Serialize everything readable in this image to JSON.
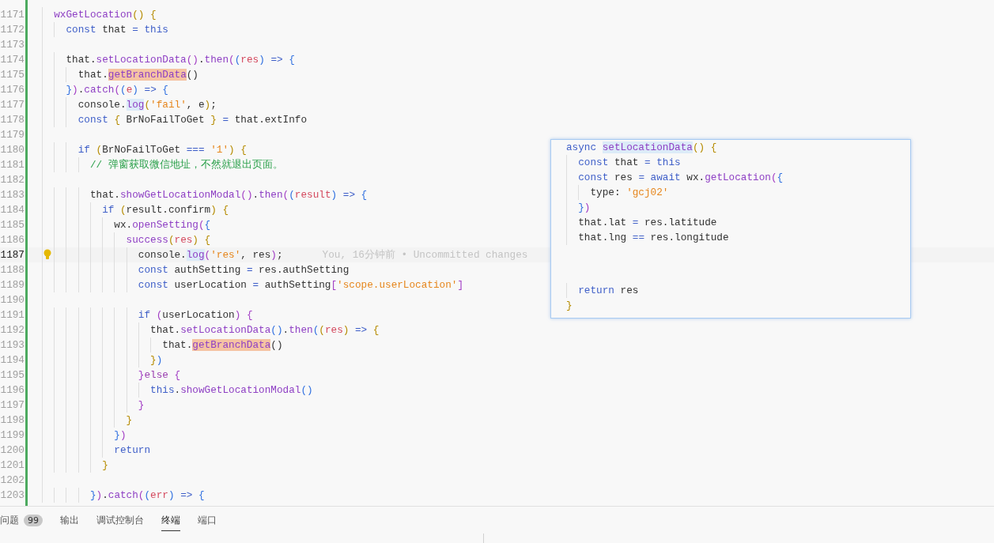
{
  "editor": {
    "lines": [
      {
        "number": "1171",
        "current": false,
        "tokens": [
          {
            "text": "  wxGetLocation",
            "kind": "fn"
          },
          {
            "text": "() {",
            "kind": "b1"
          }
        ]
      },
      {
        "number": "1172",
        "current": false,
        "tokens": [
          {
            "text": "    const",
            "kind": "kw"
          },
          {
            "text": " that ",
            "kind": "p"
          },
          {
            "text": "= ",
            "kind": "op"
          },
          {
            "text": "this",
            "kind": "kw"
          }
        ]
      },
      {
        "number": "1173",
        "current": false
      },
      {
        "number": "1174",
        "current": false,
        "tokens": [
          {
            "text": "    that.",
            "kind": "p"
          },
          {
            "text": "setLocationData",
            "kind": "fn"
          },
          {
            "text": "()",
            "kind": "b2"
          },
          {
            "text": ".",
            "kind": "p"
          },
          {
            "text": "then",
            "kind": "fn"
          },
          {
            "text": "(",
            "kind": "b2"
          },
          {
            "text": "(",
            "kind": "b3"
          },
          {
            "text": "res",
            "kind": "pr"
          },
          {
            "text": ") ",
            "kind": "b3"
          },
          {
            "text": "=> ",
            "kind": "op"
          },
          {
            "text": "{",
            "kind": "b3"
          }
        ]
      },
      {
        "number": "1175",
        "current": false,
        "tokens": [
          {
            "text": "      that.",
            "kind": "p"
          },
          {
            "text": "getBranchData",
            "kind": "fn_match"
          },
          {
            "text": "()",
            "kind": "p"
          }
        ]
      },
      {
        "number": "1176",
        "current": false,
        "tokens": [
          {
            "text": "    }",
            "kind": "b3"
          },
          {
            "text": ")",
            "kind": "b2"
          },
          {
            "text": ".",
            "kind": "p"
          },
          {
            "text": "catch",
            "kind": "fn"
          },
          {
            "text": "(",
            "kind": "b2"
          },
          {
            "text": "(",
            "kind": "b3"
          },
          {
            "text": "e",
            "kind": "pr"
          },
          {
            "text": ") ",
            "kind": "b3"
          },
          {
            "text": "=> ",
            "kind": "op"
          },
          {
            "text": "{",
            "kind": "b3"
          }
        ]
      },
      {
        "number": "1177",
        "current": false,
        "tokens": [
          {
            "text": "      console.",
            "kind": "p"
          },
          {
            "text": "log",
            "kind": "fn_ref"
          },
          {
            "text": "(",
            "kind": "b1"
          },
          {
            "text": "'fail'",
            "kind": "st"
          },
          {
            "text": ", e",
            "kind": "p"
          },
          {
            "text": ")",
            "kind": "b1"
          },
          {
            "text": ";",
            "kind": "p"
          }
        ]
      },
      {
        "number": "1178",
        "current": false,
        "tokens": [
          {
            "text": "      const ",
            "kind": "kw"
          },
          {
            "text": "{",
            "kind": "b1"
          },
          {
            "text": " BrNoFailToGet ",
            "kind": "p"
          },
          {
            "text": "} ",
            "kind": "b1"
          },
          {
            "text": "=",
            "kind": "op"
          },
          {
            "text": " that.extInfo",
            "kind": "p"
          }
        ]
      },
      {
        "number": "1179",
        "current": false
      },
      {
        "number": "1180",
        "current": false,
        "tokens": [
          {
            "text": "      if ",
            "kind": "kw"
          },
          {
            "text": "(",
            "kind": "b1"
          },
          {
            "text": "BrNoFailToGet ",
            "kind": "p"
          },
          {
            "text": "=== ",
            "kind": "op"
          },
          {
            "text": "'1'",
            "kind": "st"
          },
          {
            "text": ") {",
            "kind": "b1"
          }
        ]
      },
      {
        "number": "1181",
        "current": false,
        "tokens": [
          {
            "text": "        // 弹窗获取微信地址，不然就退出页面。",
            "kind": "cm"
          }
        ]
      },
      {
        "number": "1182",
        "current": false
      },
      {
        "number": "1183",
        "current": false,
        "tokens": [
          {
            "text": "        that.",
            "kind": "p"
          },
          {
            "text": "showGetLocationModal",
            "kind": "fn"
          },
          {
            "text": "()",
            "kind": "b2"
          },
          {
            "text": ".",
            "kind": "p"
          },
          {
            "text": "then",
            "kind": "fn"
          },
          {
            "text": "(",
            "kind": "b2"
          },
          {
            "text": "(",
            "kind": "b3"
          },
          {
            "text": "result",
            "kind": "pr"
          },
          {
            "text": ") ",
            "kind": "b3"
          },
          {
            "text": "=> ",
            "kind": "op"
          },
          {
            "text": "{",
            "kind": "b3"
          }
        ]
      },
      {
        "number": "1184",
        "current": false,
        "tokens": [
          {
            "text": "          if ",
            "kind": "kw"
          },
          {
            "text": "(",
            "kind": "b1"
          },
          {
            "text": "result.confirm",
            "kind": "p"
          },
          {
            "text": ") {",
            "kind": "b1"
          }
        ]
      },
      {
        "number": "1185",
        "current": false,
        "tokens": [
          {
            "text": "            wx.",
            "kind": "p"
          },
          {
            "text": "openSetting",
            "kind": "fn"
          },
          {
            "text": "(",
            "kind": "b2"
          },
          {
            "text": "{",
            "kind": "b3"
          }
        ]
      },
      {
        "number": "1186",
        "current": false,
        "tokens": [
          {
            "text": "              success",
            "kind": "fn"
          },
          {
            "text": "(",
            "kind": "b1"
          },
          {
            "text": "res",
            "kind": "pr"
          },
          {
            "text": ") {",
            "kind": "b1"
          }
        ]
      },
      {
        "number": "1187",
        "current": true,
        "annotation": "You, 16分钟前 • Uncommitted changes",
        "tokens": [
          {
            "text": "                console.",
            "kind": "p"
          },
          {
            "text": "log",
            "kind": "fn_ref"
          },
          {
            "text": "(",
            "kind": "b2"
          },
          {
            "text": "'res'",
            "kind": "st"
          },
          {
            "text": ", res",
            "kind": "p"
          },
          {
            "text": ")",
            "kind": "b2"
          },
          {
            "text": ";",
            "kind": "p"
          }
        ]
      },
      {
        "number": "1188",
        "current": false,
        "tokens": [
          {
            "text": "                const",
            "kind": "kw"
          },
          {
            "text": " authSetting ",
            "kind": "p"
          },
          {
            "text": "=",
            "kind": "op"
          },
          {
            "text": " res.authSetting",
            "kind": "p"
          }
        ]
      },
      {
        "number": "1189",
        "current": false,
        "tokens": [
          {
            "text": "                const",
            "kind": "kw"
          },
          {
            "text": " userLocation ",
            "kind": "p"
          },
          {
            "text": "=",
            "kind": "op"
          },
          {
            "text": " authSetting",
            "kind": "p"
          },
          {
            "text": "[",
            "kind": "b2"
          },
          {
            "text": "'scope.userLocation'",
            "kind": "st"
          },
          {
            "text": "]",
            "kind": "b2"
          }
        ]
      },
      {
        "number": "1190",
        "current": false
      },
      {
        "number": "1191",
        "current": false,
        "tokens": [
          {
            "text": "                if ",
            "kind": "kw"
          },
          {
            "text": "(",
            "kind": "b2"
          },
          {
            "text": "userLocation",
            "kind": "p"
          },
          {
            "text": ") {",
            "kind": "b2"
          }
        ]
      },
      {
        "number": "1192",
        "current": false,
        "tokens": [
          {
            "text": "                  that.",
            "kind": "p"
          },
          {
            "text": "setLocationData",
            "kind": "fn"
          },
          {
            "text": "()",
            "kind": "b3"
          },
          {
            "text": ".",
            "kind": "p"
          },
          {
            "text": "then",
            "kind": "fn"
          },
          {
            "text": "(",
            "kind": "b3"
          },
          {
            "text": "(",
            "kind": "b1"
          },
          {
            "text": "res",
            "kind": "pr"
          },
          {
            "text": ") ",
            "kind": "b1"
          },
          {
            "text": "=> ",
            "kind": "op"
          },
          {
            "text": "{",
            "kind": "b1"
          }
        ]
      },
      {
        "number": "1193",
        "current": false,
        "tokens": [
          {
            "text": "                    that.",
            "kind": "p"
          },
          {
            "text": "getBranchData",
            "kind": "fn_match"
          },
          {
            "text": "()",
            "kind": "p"
          }
        ]
      },
      {
        "number": "1194",
        "current": false,
        "tokens": [
          {
            "text": "                  }",
            "kind": "b1"
          },
          {
            "text": ")",
            "kind": "b3"
          }
        ]
      },
      {
        "number": "1195",
        "current": false,
        "tokens": [
          {
            "text": "                }",
            "kind": "b2"
          },
          {
            "text": "else ",
            "kind": "kw2"
          },
          {
            "text": "{",
            "kind": "b2"
          }
        ]
      },
      {
        "number": "1196",
        "current": false,
        "tokens": [
          {
            "text": "                  this",
            "kind": "kw"
          },
          {
            "text": ".",
            "kind": "p"
          },
          {
            "text": "showGetLocationModal",
            "kind": "fn"
          },
          {
            "text": "()",
            "kind": "b3"
          }
        ]
      },
      {
        "number": "1197",
        "current": false,
        "tokens": [
          {
            "text": "                }",
            "kind": "b2"
          }
        ]
      },
      {
        "number": "1198",
        "current": false,
        "tokens": [
          {
            "text": "              }",
            "kind": "b1"
          }
        ]
      },
      {
        "number": "1199",
        "current": false,
        "tokens": [
          {
            "text": "            }",
            "kind": "b3"
          },
          {
            "text": ")",
            "kind": "b2"
          }
        ]
      },
      {
        "number": "1200",
        "current": false,
        "tokens": [
          {
            "text": "            return",
            "kind": "kw"
          }
        ]
      },
      {
        "number": "1201",
        "current": false,
        "tokens": [
          {
            "text": "          }",
            "kind": "b1"
          }
        ]
      },
      {
        "number": "1202",
        "current": false
      },
      {
        "number": "1203",
        "current": false,
        "tokens": [
          {
            "text": "        }",
            "kind": "b3"
          },
          {
            "text": ")",
            "kind": "b2"
          },
          {
            "text": ".",
            "kind": "p"
          },
          {
            "text": "catch",
            "kind": "fn"
          },
          {
            "text": "(",
            "kind": "b2"
          },
          {
            "text": "(",
            "kind": "b3"
          },
          {
            "text": "err",
            "kind": "pr"
          },
          {
            "text": ") ",
            "kind": "b3"
          },
          {
            "text": "=> ",
            "kind": "op"
          },
          {
            "text": "{",
            "kind": "b3"
          }
        ]
      }
    ]
  },
  "hover_preview": {
    "lines": [
      {
        "tokens": [
          {
            "text": "async ",
            "kind": "kw"
          },
          {
            "text": "setLocationData",
            "kind": "fn_ref"
          },
          {
            "text": "() {",
            "kind": "b1"
          }
        ]
      },
      {
        "tokens": [
          {
            "text": "  const",
            "kind": "kw"
          },
          {
            "text": " that ",
            "kind": "p"
          },
          {
            "text": "= ",
            "kind": "op"
          },
          {
            "text": "this",
            "kind": "kw"
          }
        ]
      },
      {
        "tokens": [
          {
            "text": "  const",
            "kind": "kw"
          },
          {
            "text": " res ",
            "kind": "p"
          },
          {
            "text": "= ",
            "kind": "op"
          },
          {
            "text": "await",
            "kind": "kw"
          },
          {
            "text": " wx.",
            "kind": "p"
          },
          {
            "text": "getLocation",
            "kind": "fn"
          },
          {
            "text": "(",
            "kind": "b2"
          },
          {
            "text": "{",
            "kind": "b3"
          }
        ]
      },
      {
        "tokens": [
          {
            "text": "    type: ",
            "kind": "p"
          },
          {
            "text": "'gcj02'",
            "kind": "st"
          }
        ]
      },
      {
        "tokens": [
          {
            "text": "  }",
            "kind": "b3"
          },
          {
            "text": ")",
            "kind": "b2"
          }
        ]
      },
      {
        "tokens": [
          {
            "text": "  that.lat ",
            "kind": "p"
          },
          {
            "text": "=",
            "kind": "op"
          },
          {
            "text": " res.latitude",
            "kind": "p"
          }
        ]
      },
      {
        "tokens": [
          {
            "text": "  that.lng ",
            "kind": "p"
          },
          {
            "text": "==",
            "kind": "op"
          },
          {
            "text": " res.longitude",
            "kind": "p"
          }
        ]
      },
      {
        "tokens": [
          {
            "text": "  return",
            "kind": "kw"
          },
          {
            "text": " res",
            "kind": "p"
          }
        ]
      },
      {
        "tokens": [
          {
            "text": "}",
            "kind": "b1"
          }
        ]
      }
    ]
  },
  "panel": {
    "tabs": [
      {
        "label": "问题",
        "badge": "99",
        "selected": false
      },
      {
        "label": "输出",
        "selected": false
      },
      {
        "label": "调试控制台",
        "selected": false
      },
      {
        "label": "终端",
        "selected": true
      },
      {
        "label": "端口",
        "selected": false
      }
    ]
  }
}
